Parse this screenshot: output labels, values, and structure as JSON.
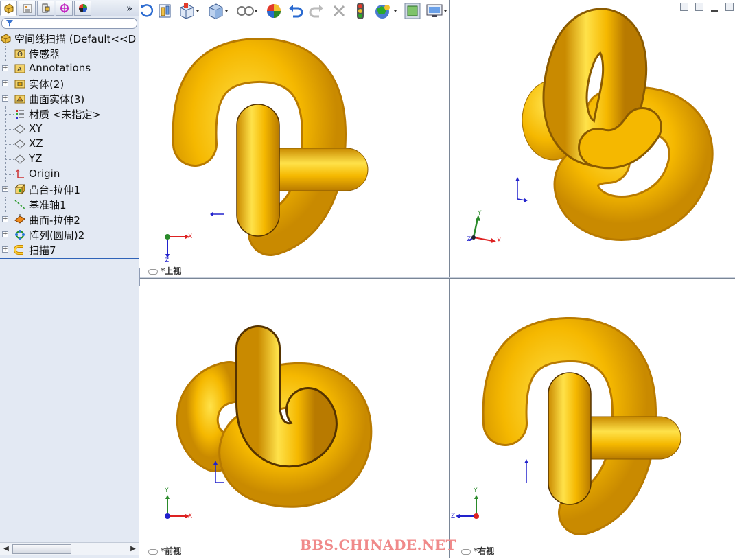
{
  "panel_tabs": [
    {
      "icon": "feature-manager-icon",
      "active": true
    },
    {
      "icon": "property-manager-icon",
      "active": false
    },
    {
      "icon": "configuration-manager-icon",
      "active": false
    },
    {
      "icon": "dimxpert-icon",
      "active": false
    },
    {
      "icon": "display-manager-icon",
      "active": false
    }
  ],
  "more_tabs": "»",
  "tree": {
    "root": "空间线扫描  (Default<<D",
    "items": [
      {
        "label": "传感器",
        "icon": "sensor-folder-icon",
        "expandable": false
      },
      {
        "label": "Annotations",
        "icon": "annotations-icon",
        "expandable": true
      },
      {
        "label": "实体(2)",
        "icon": "solid-bodies-icon",
        "expandable": true
      },
      {
        "label": "曲面实体(3)",
        "icon": "surface-bodies-icon",
        "expandable": true
      },
      {
        "label": "材质 <未指定>",
        "icon": "material-icon",
        "expandable": false
      },
      {
        "label": "XY",
        "icon": "plane-icon",
        "expandable": false
      },
      {
        "label": "XZ",
        "icon": "plane-icon",
        "expandable": false
      },
      {
        "label": "YZ",
        "icon": "plane-icon",
        "expandable": false
      },
      {
        "label": "Origin",
        "icon": "origin-icon",
        "expandable": false
      },
      {
        "label": "凸台-拉伸1",
        "icon": "boss-extrude-icon",
        "expandable": true
      },
      {
        "label": "基准轴1",
        "icon": "axis-icon",
        "expandable": false
      },
      {
        "label": "曲面-拉伸2",
        "icon": "surface-extrude-icon",
        "expandable": true
      },
      {
        "label": "阵列(圆周)2",
        "icon": "circular-pattern-icon",
        "expandable": true
      },
      {
        "label": "扫描7",
        "icon": "sweep-icon",
        "expandable": true
      }
    ]
  },
  "toolbar": [
    "rotate-view-icon",
    "zoom-to-fit-icon",
    "section-view-icon",
    "view-orientation-icon",
    "display-style-icon",
    "appearance-icon",
    "undo-icon",
    "redo-icon",
    "cancel-icon",
    "traffic-light-icon",
    "scene-icon",
    "shaded-icon",
    "monitor-icon"
  ],
  "viewports": {
    "top": {
      "label": "*上视",
      "triad": [
        "X",
        "Z"
      ]
    },
    "iso": {
      "label": "",
      "triad": [
        "Y",
        "X",
        "Z"
      ]
    },
    "front": {
      "label": "*前视",
      "triad": [
        "Y",
        "X"
      ]
    },
    "right": {
      "label": "*右视",
      "triad": [
        "Y",
        "Z"
      ]
    }
  },
  "colors": {
    "model": "#f5b800",
    "model_shadow": "#c98a00",
    "model_highlight": "#ffe24a"
  },
  "watermark": "BBS.CHINADE.NET"
}
